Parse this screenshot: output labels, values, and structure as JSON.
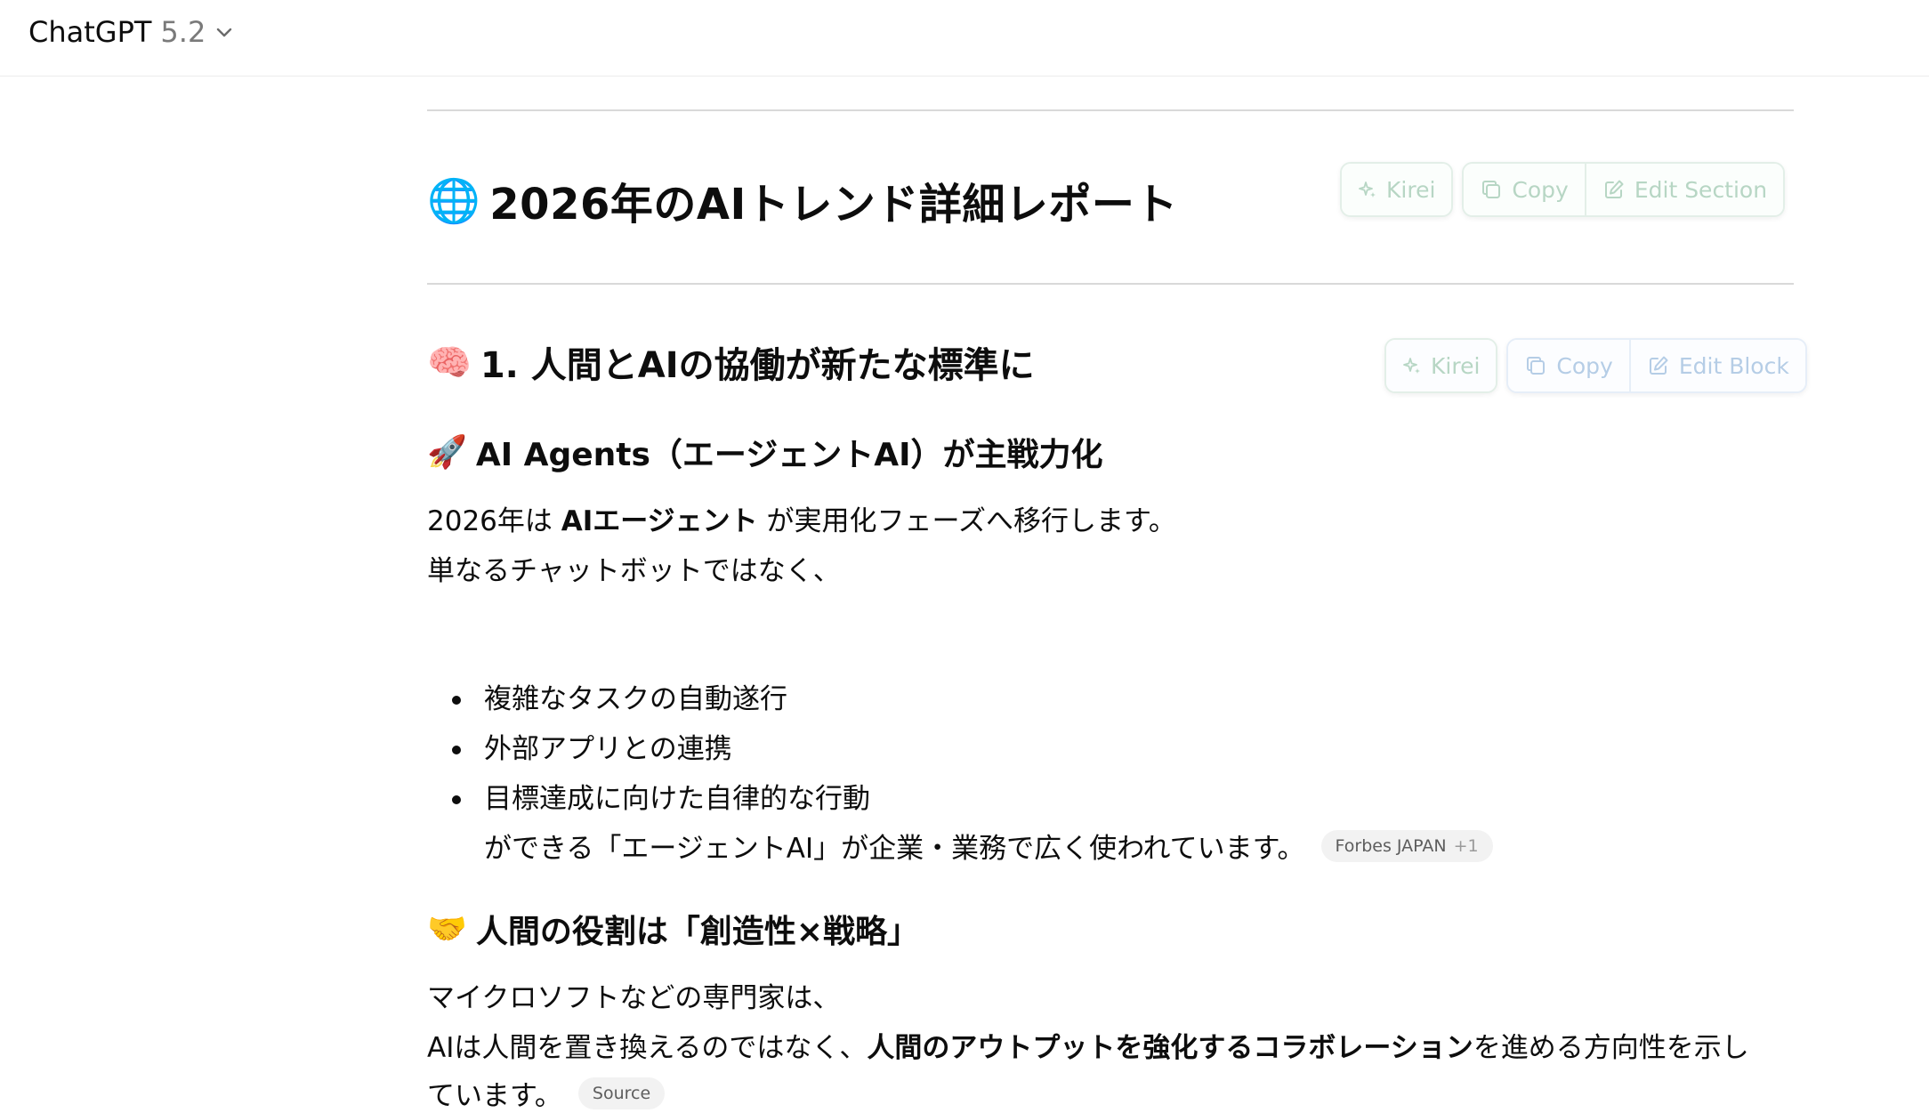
{
  "header": {
    "model_name": "ChatGPT",
    "model_version": "5.2"
  },
  "colors": {
    "kirei_button": "#b7d6c4",
    "copy_button": "#b5cde6",
    "citation_bg": "#f2f2f2",
    "rule": "#d9d9d9"
  },
  "report": {
    "title_emoji": "🌐",
    "title": "2026年のAIトレンド詳細レポート",
    "section_toolbar": {
      "kirei": "Kirei",
      "copy": "Copy",
      "edit": "Edit Section"
    },
    "section1": {
      "emoji": "🧠",
      "heading": "1. 人間とAIの協働が新たな標準に",
      "toolbar": {
        "kirei": "Kirei",
        "copy": "Copy",
        "edit": "Edit Block"
      },
      "sub1": {
        "emoji": "🚀",
        "heading": "AI Agents（エージェントAI）が主戦力化",
        "line1_pre": "2026年は ",
        "line1_bold": "AIエージェント",
        "line1_post": " が実用化フェーズへ移行します。",
        "line2": "単なるチャットボットではなく、",
        "bullets": [
          "複雑なタスクの自動遂行",
          "外部アプリとの連携",
          "目標達成に向けた自律的な行動"
        ],
        "continuation": "ができる「エージェントAI」が企業・業務で広く使われています。",
        "citation": {
          "source": "Forbes JAPAN",
          "more": "+1"
        }
      },
      "sub2": {
        "emoji": "🤝",
        "heading": "人間の役割は「創造性×戦略」",
        "line1": "マイクロソフトなどの専門家は、",
        "line2_pre": "AIは人間を置き換えるのではなく、",
        "line2_bold": "人間のアウトプットを強化するコラボレーション",
        "line2_post": "を進める方向性を示し",
        "line3": "ています。",
        "citation": {
          "source": "Source"
        }
      }
    }
  }
}
